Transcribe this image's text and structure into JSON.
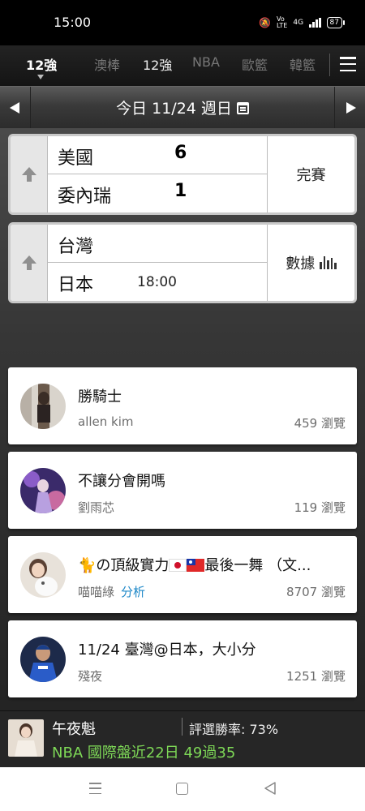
{
  "status_bar": {
    "time": "15:00",
    "network_label": "4G",
    "battery": "87"
  },
  "tabs": [
    {
      "label": "12強",
      "state": "active"
    },
    {
      "label": "澳棒",
      "state": ""
    },
    {
      "label": "12強",
      "state": "current"
    },
    {
      "label": "NBA",
      "state": ""
    },
    {
      "label": "歐籃",
      "state": ""
    },
    {
      "label": "韓籃",
      "state": ""
    }
  ],
  "date_bar": {
    "date_label": "今日 11/24 週日"
  },
  "games": [
    {
      "team1": "美國",
      "score1": "6",
      "team2": "委內瑞",
      "score2": "1",
      "time": "",
      "status": "完賽"
    },
    {
      "team1": "台灣",
      "score1": "",
      "team2": "日本",
      "score2": "",
      "time": "18:00",
      "status": "數據"
    }
  ],
  "articles": [
    {
      "title_prefix": "",
      "title": "勝騎士",
      "author": "allen kim",
      "tag": "",
      "views": "459 瀏覽"
    },
    {
      "title_prefix": "",
      "title": "不讓分會開嗎",
      "author": "劉雨芯",
      "tag": "",
      "views": "119 瀏覽"
    },
    {
      "title_prefix": "の頂級實力",
      "title": "最後一舞 （文...",
      "author": "喵喵綠",
      "tag": "分析",
      "views": "8707 瀏覽"
    },
    {
      "title_prefix": "",
      "title": "11/24 臺灣@日本，大小分",
      "author": "殘夜",
      "tag": "",
      "views": "1251 瀏覽"
    }
  ],
  "promo": {
    "name": "午夜魁",
    "rate": "評選勝率: 73%",
    "record": "NBA 國際盤近22日 49過35"
  },
  "colors": {
    "accent_blue": "#1e88c8",
    "record_green": "#7ed957"
  }
}
